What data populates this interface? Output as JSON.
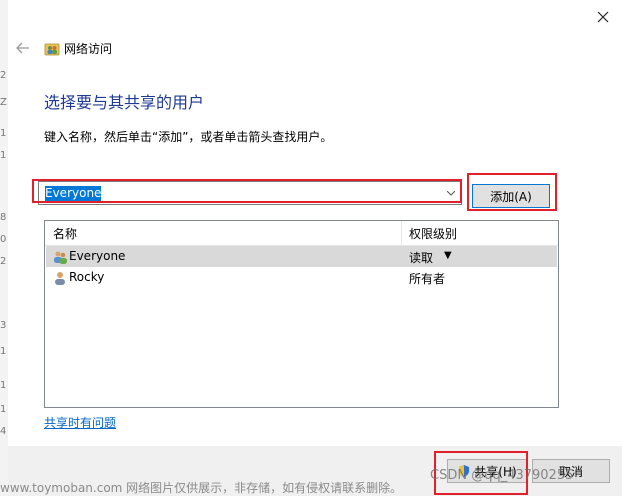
{
  "edge_fragments": [
    "2",
    "Z",
    "1",
    "1",
    "8",
    "0",
    "2",
    "3",
    "1",
    "1",
    "1",
    "4"
  ],
  "window": {
    "title": "网络访问",
    "close_icon": "close-icon",
    "back_icon": "back-arrow-icon"
  },
  "main": {
    "heading": "选择要与其共享的用户",
    "instruction": "键入名称，然后单击“添加”，或者单击箭头查找用户。",
    "name_input_value": "Everyone",
    "add_button_label": "添加(A)"
  },
  "user_list": {
    "columns": [
      "名称",
      "权限级别"
    ],
    "rows": [
      {
        "name": "Everyone",
        "permission": "读取",
        "icon": "user-group-icon",
        "selected": true,
        "has_dropdown": true
      },
      {
        "name": "Rocky",
        "permission": "所有者",
        "icon": "user-icon",
        "selected": false,
        "has_dropdown": false
      }
    ]
  },
  "help_link": "共享时有问题",
  "footer": {
    "share_button_label": "共享(H)",
    "cancel_button_label": "取消"
  },
  "watermarks": {
    "left": "www.toymoban.com 网络图片仅供展示，非存储，如有侵权请联系删除。",
    "right": "CSDN @qq_43790255"
  },
  "colors": {
    "heading": "#1f3a93",
    "link": "#0066cc",
    "annotation_red": "#e0202a",
    "selection": "#0078d7"
  }
}
